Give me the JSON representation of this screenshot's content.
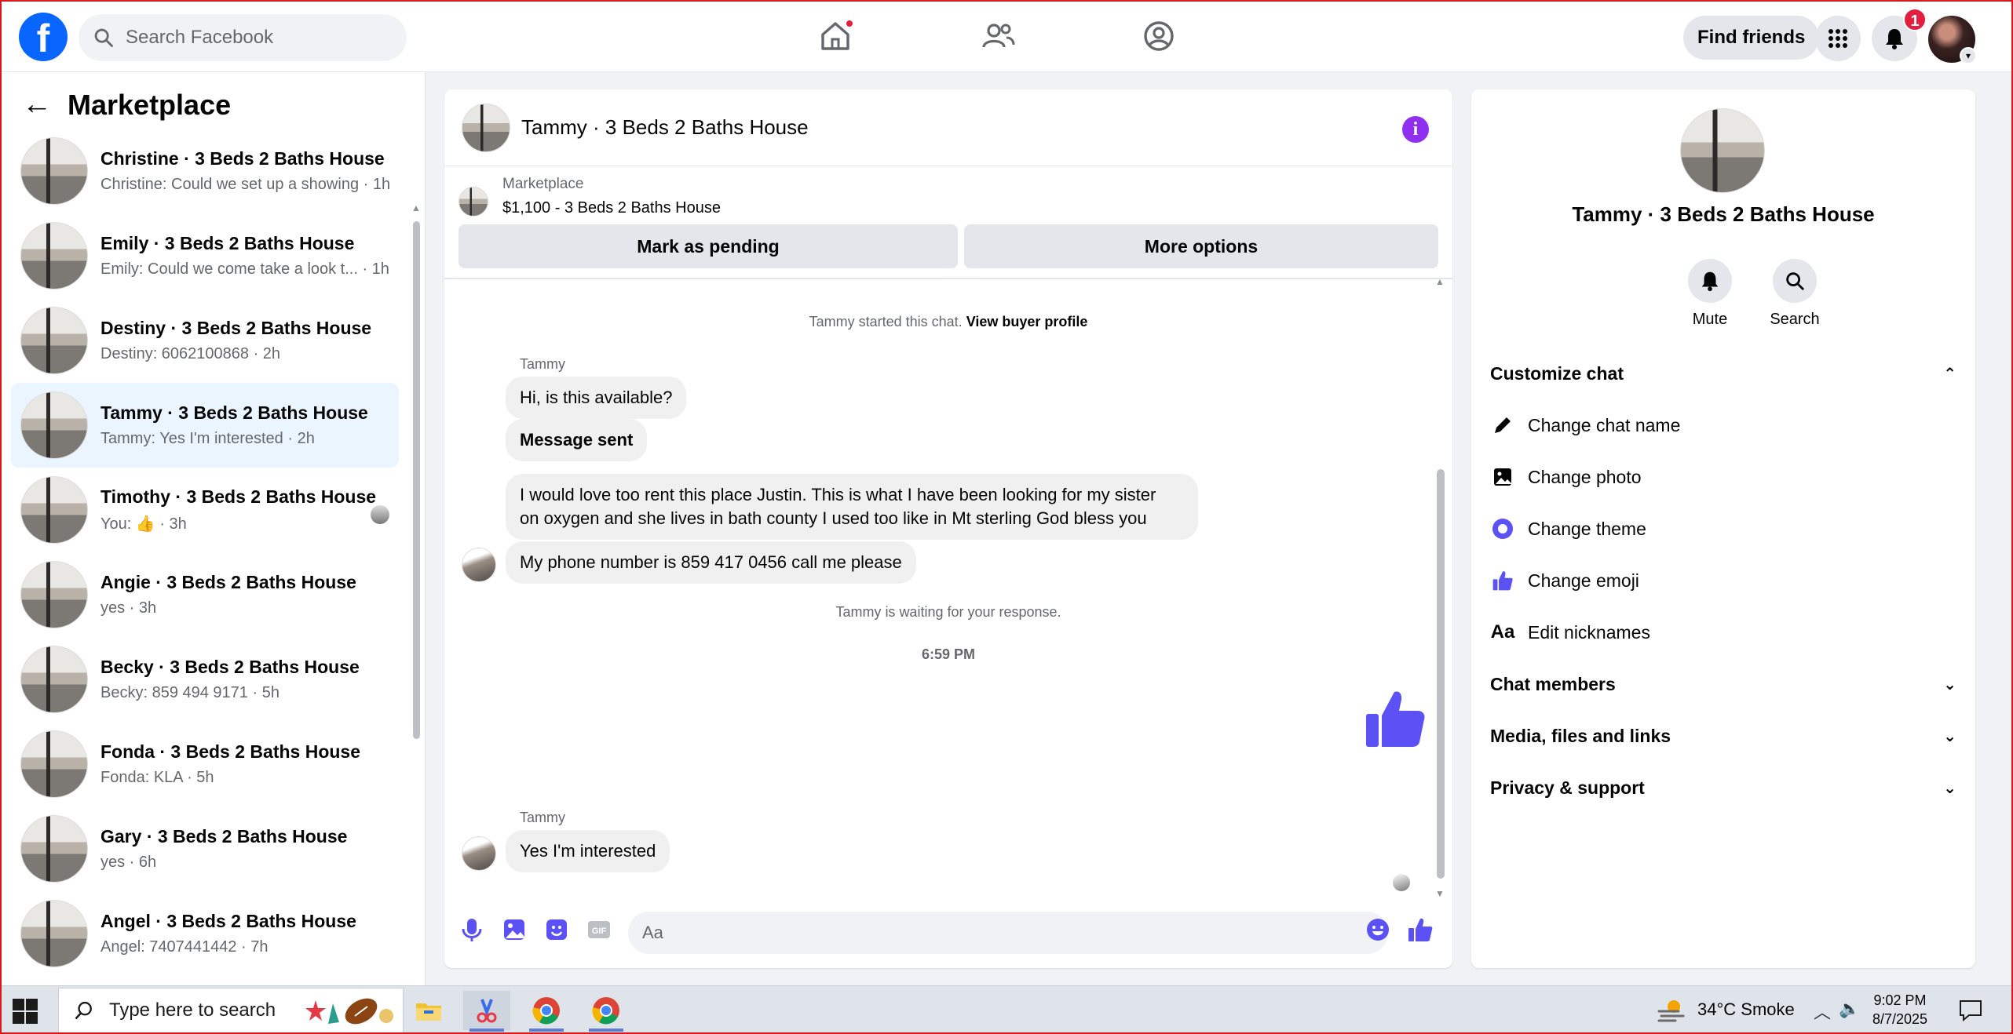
{
  "topbar": {
    "search_placeholder": "Search Facebook",
    "find_friends": "Find friends",
    "notification_count": "1",
    "brand_color": "#0866ff"
  },
  "left": {
    "title": "Marketplace",
    "chats": [
      {
        "name": "Christine · 3 Beds 2 Baths House",
        "snippet": "Christine: Could we set up a showing · 1h"
      },
      {
        "name": "Emily · 3 Beds 2 Baths House",
        "snippet": "Emily: Could we come take a look t... · 1h"
      },
      {
        "name": "Destiny · 3 Beds 2 Baths House",
        "snippet": "Destiny: 6062100868 · 2h"
      },
      {
        "name": "Tammy · 3 Beds 2 Baths House",
        "snippet": "Tammy: Yes I'm interested · 2h"
      },
      {
        "name": "Timothy · 3 Beds 2 Baths House",
        "snippet_prefix": "You:",
        "snippet_suffix": "· 3h"
      },
      {
        "name": "Angie · 3 Beds 2 Baths House",
        "snippet": "yes · 3h"
      },
      {
        "name": "Becky · 3 Beds 2 Baths House",
        "snippet": "Becky: 859 494 9171 · 5h"
      },
      {
        "name": "Fonda · 3 Beds 2 Baths House",
        "snippet": "Fonda: KLA · 5h"
      },
      {
        "name": "Gary · 3 Beds 2 Baths House",
        "snippet": "yes · 6h"
      },
      {
        "name": "Angel · 3 Beds 2 Baths House",
        "snippet": "Angel: 7407441442 · 7h"
      }
    ]
  },
  "chat": {
    "title": "Tammy · 3 Beds 2 Baths House",
    "listing_label": "Marketplace",
    "listing_price": "$1,100 - 3 Beds 2 Baths House",
    "mark_pending": "Mark as pending",
    "more_options": "More options",
    "started_text": "Tammy started this chat.",
    "view_profile": "View buyer profile",
    "sender": "Tammy",
    "msg1": "Hi, is this available?",
    "msg2": "Message sent",
    "msg3_line1": "I would love too rent this place Justin. This is what I have been looking for my sister",
    "msg3_line2": "on oxygen and she lives in bath county I used too like in Mt sterling God bless you",
    "msg4": "My phone number is 859 417 0456 call me please",
    "waiting": "Tammy is waiting for your response.",
    "time": "6:59 PM",
    "sender2": "Tammy",
    "msg5": "Yes I'm interested",
    "composer_placeholder": "Aa",
    "accent": "#5b51f5"
  },
  "right": {
    "title": "Tammy · 3 Beds 2 Baths House",
    "mute": "Mute",
    "search": "Search",
    "customize": "Customize chat",
    "change_name": "Change chat name",
    "change_photo": "Change photo",
    "change_theme": "Change theme",
    "change_emoji": "Change emoji",
    "edit_nicknames": "Edit nicknames",
    "chat_members": "Chat members",
    "media": "Media, files and links",
    "privacy": "Privacy & support"
  },
  "taskbar": {
    "search_placeholder": "Type here to search",
    "weather": "34°C  Smoke",
    "time": "9:02 PM",
    "date": "8/7/2025"
  }
}
